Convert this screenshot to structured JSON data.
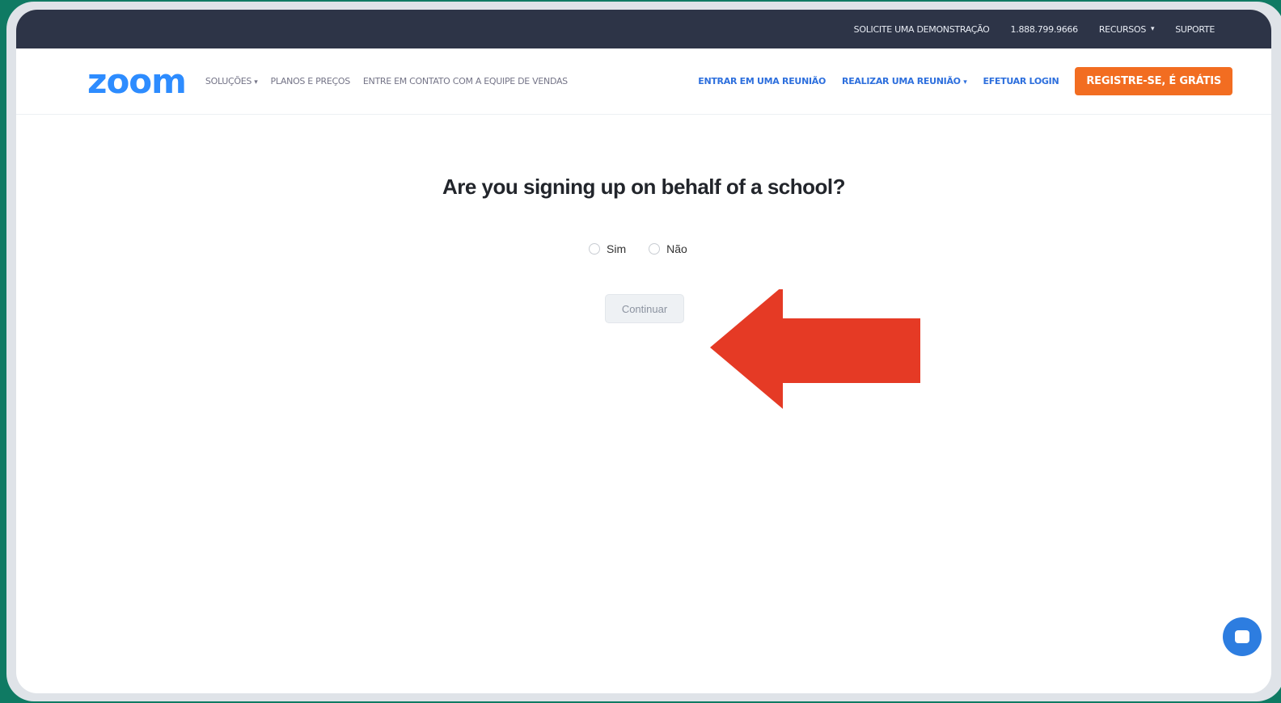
{
  "topbar": {
    "items": [
      {
        "label": "SOLICITE UMA DEMONSTRAÇÃO"
      },
      {
        "label": "1.888.799.9666"
      },
      {
        "label": "RECURSOS",
        "caret": "▾"
      },
      {
        "label": "SUPORTE"
      }
    ]
  },
  "nav": {
    "logo": "zoom",
    "left_links": [
      {
        "label": "SOLUÇÕES",
        "caret": "▾"
      },
      {
        "label": "PLANOS E PREÇOS"
      },
      {
        "label": "ENTRE EM CONTATO COM A EQUIPE DE VENDAS"
      }
    ],
    "right_links": [
      {
        "label": "ENTRAR EM UMA REUNIÃO"
      },
      {
        "label": "REALIZAR UMA REUNIÃO",
        "caret": "▾"
      },
      {
        "label": "EFETUAR LOGIN"
      }
    ],
    "signup_label": "REGISTRE-SE, É GRÁTIS"
  },
  "form": {
    "question": "Are you signing up on behalf of a school?",
    "options": [
      "Sim",
      "Não"
    ],
    "continue_label": "Continuar"
  },
  "icons": {
    "arrow": "left-arrow-icon",
    "chat": "chat-icon"
  },
  "colors": {
    "brand": "#2d8cff",
    "signup": "#f26d21",
    "arrow": "#e53a25",
    "topbar": "#2d3447"
  }
}
